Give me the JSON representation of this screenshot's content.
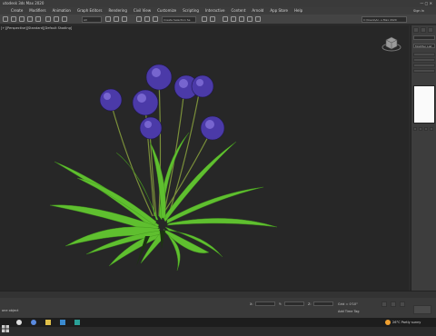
{
  "window": {
    "title": "utodesk 3ds Max 2020",
    "signin": "Sign In"
  },
  "menu": [
    "Create",
    "Modifiers",
    "Animation",
    "Graph Editors",
    "Rendering",
    "Civil View",
    "Customize",
    "Scripting",
    "Interactive",
    "Content",
    "Arnold",
    "App Store",
    "Help"
  ],
  "toolbar": {
    "filter_value": "All",
    "selection_set": "Create Selection Se",
    "workspace": "C:\\Users\\Ar...s Max 2020"
  },
  "viewport": {
    "label": "[+][Perspective][Standard][Default Shading]"
  },
  "command_panel": {
    "modifier_list": "Modifier List"
  },
  "status": {
    "left": "one object",
    "x_label": "X:",
    "y_label": "Y:",
    "z_label": "Z:",
    "grid": "Grid = 0'10\"",
    "add_time_tag": "Add Time Tag"
  },
  "taskbar": {
    "weather": "26°C  Partly sunny"
  },
  "colors": {
    "viewport_bg": "#272727",
    "leaf": "#5fbf2f",
    "flower": "#4b3aa8"
  }
}
